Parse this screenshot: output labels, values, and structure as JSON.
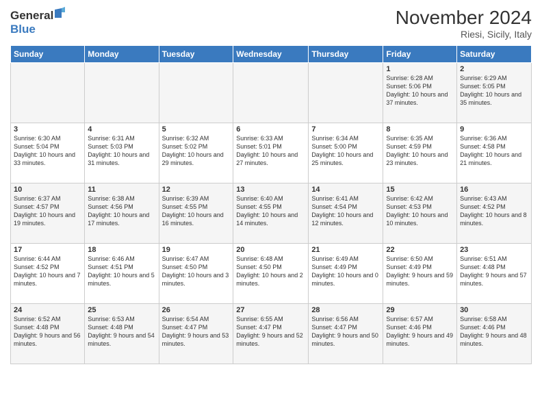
{
  "logo": {
    "line1": "General",
    "line2": "Blue"
  },
  "title": "November 2024",
  "location": "Riesi, Sicily, Italy",
  "days_of_week": [
    "Sunday",
    "Monday",
    "Tuesday",
    "Wednesday",
    "Thursday",
    "Friday",
    "Saturday"
  ],
  "weeks": [
    [
      {
        "day": "",
        "info": ""
      },
      {
        "day": "",
        "info": ""
      },
      {
        "day": "",
        "info": ""
      },
      {
        "day": "",
        "info": ""
      },
      {
        "day": "",
        "info": ""
      },
      {
        "day": "1",
        "info": "Sunrise: 6:28 AM\nSunset: 5:06 PM\nDaylight: 10 hours and 37 minutes."
      },
      {
        "day": "2",
        "info": "Sunrise: 6:29 AM\nSunset: 5:05 PM\nDaylight: 10 hours and 35 minutes."
      }
    ],
    [
      {
        "day": "3",
        "info": "Sunrise: 6:30 AM\nSunset: 5:04 PM\nDaylight: 10 hours and 33 minutes."
      },
      {
        "day": "4",
        "info": "Sunrise: 6:31 AM\nSunset: 5:03 PM\nDaylight: 10 hours and 31 minutes."
      },
      {
        "day": "5",
        "info": "Sunrise: 6:32 AM\nSunset: 5:02 PM\nDaylight: 10 hours and 29 minutes."
      },
      {
        "day": "6",
        "info": "Sunrise: 6:33 AM\nSunset: 5:01 PM\nDaylight: 10 hours and 27 minutes."
      },
      {
        "day": "7",
        "info": "Sunrise: 6:34 AM\nSunset: 5:00 PM\nDaylight: 10 hours and 25 minutes."
      },
      {
        "day": "8",
        "info": "Sunrise: 6:35 AM\nSunset: 4:59 PM\nDaylight: 10 hours and 23 minutes."
      },
      {
        "day": "9",
        "info": "Sunrise: 6:36 AM\nSunset: 4:58 PM\nDaylight: 10 hours and 21 minutes."
      }
    ],
    [
      {
        "day": "10",
        "info": "Sunrise: 6:37 AM\nSunset: 4:57 PM\nDaylight: 10 hours and 19 minutes."
      },
      {
        "day": "11",
        "info": "Sunrise: 6:38 AM\nSunset: 4:56 PM\nDaylight: 10 hours and 17 minutes."
      },
      {
        "day": "12",
        "info": "Sunrise: 6:39 AM\nSunset: 4:55 PM\nDaylight: 10 hours and 16 minutes."
      },
      {
        "day": "13",
        "info": "Sunrise: 6:40 AM\nSunset: 4:55 PM\nDaylight: 10 hours and 14 minutes."
      },
      {
        "day": "14",
        "info": "Sunrise: 6:41 AM\nSunset: 4:54 PM\nDaylight: 10 hours and 12 minutes."
      },
      {
        "day": "15",
        "info": "Sunrise: 6:42 AM\nSunset: 4:53 PM\nDaylight: 10 hours and 10 minutes."
      },
      {
        "day": "16",
        "info": "Sunrise: 6:43 AM\nSunset: 4:52 PM\nDaylight: 10 hours and 8 minutes."
      }
    ],
    [
      {
        "day": "17",
        "info": "Sunrise: 6:44 AM\nSunset: 4:52 PM\nDaylight: 10 hours and 7 minutes."
      },
      {
        "day": "18",
        "info": "Sunrise: 6:46 AM\nSunset: 4:51 PM\nDaylight: 10 hours and 5 minutes."
      },
      {
        "day": "19",
        "info": "Sunrise: 6:47 AM\nSunset: 4:50 PM\nDaylight: 10 hours and 3 minutes."
      },
      {
        "day": "20",
        "info": "Sunrise: 6:48 AM\nSunset: 4:50 PM\nDaylight: 10 hours and 2 minutes."
      },
      {
        "day": "21",
        "info": "Sunrise: 6:49 AM\nSunset: 4:49 PM\nDaylight: 10 hours and 0 minutes."
      },
      {
        "day": "22",
        "info": "Sunrise: 6:50 AM\nSunset: 4:49 PM\nDaylight: 9 hours and 59 minutes."
      },
      {
        "day": "23",
        "info": "Sunrise: 6:51 AM\nSunset: 4:48 PM\nDaylight: 9 hours and 57 minutes."
      }
    ],
    [
      {
        "day": "24",
        "info": "Sunrise: 6:52 AM\nSunset: 4:48 PM\nDaylight: 9 hours and 56 minutes."
      },
      {
        "day": "25",
        "info": "Sunrise: 6:53 AM\nSunset: 4:48 PM\nDaylight: 9 hours and 54 minutes."
      },
      {
        "day": "26",
        "info": "Sunrise: 6:54 AM\nSunset: 4:47 PM\nDaylight: 9 hours and 53 minutes."
      },
      {
        "day": "27",
        "info": "Sunrise: 6:55 AM\nSunset: 4:47 PM\nDaylight: 9 hours and 52 minutes."
      },
      {
        "day": "28",
        "info": "Sunrise: 6:56 AM\nSunset: 4:47 PM\nDaylight: 9 hours and 50 minutes."
      },
      {
        "day": "29",
        "info": "Sunrise: 6:57 AM\nSunset: 4:46 PM\nDaylight: 9 hours and 49 minutes."
      },
      {
        "day": "30",
        "info": "Sunrise: 6:58 AM\nSunset: 4:46 PM\nDaylight: 9 hours and 48 minutes."
      }
    ]
  ]
}
